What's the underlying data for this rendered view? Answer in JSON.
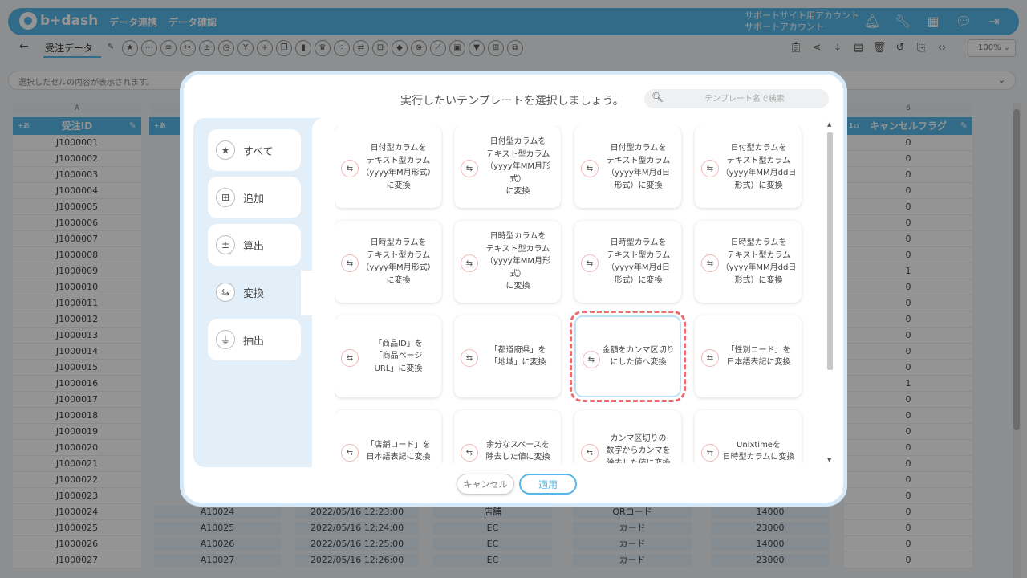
{
  "app": {
    "logo": "b+dash",
    "nav": [
      "データ連携",
      "データ確認"
    ],
    "account_line1": "サポートサイト用アカウント",
    "account_line2": "サポートアカウント",
    "top_icons": [
      "bell-icon",
      "wrench-icon",
      "grid-icon",
      "chat-icon",
      "logout-icon"
    ]
  },
  "toolbar": {
    "sheet_tab": "受注データ",
    "zoom": "100%"
  },
  "cellbar": {
    "placeholder": "選択したセルの内容が表示されます。"
  },
  "grid": {
    "col_a_letter": "A",
    "col_a_header": "受注ID",
    "col_g_letter": "6",
    "col_g_header": "キャンセルフラグ",
    "rows": [
      {
        "id": "J1000001",
        "flag": "0"
      },
      {
        "id": "J1000002",
        "flag": "0"
      },
      {
        "id": "J1000003",
        "flag": "0"
      },
      {
        "id": "J1000004",
        "flag": "0"
      },
      {
        "id": "J1000005",
        "flag": "0"
      },
      {
        "id": "J1000006",
        "flag": "0"
      },
      {
        "id": "J1000007",
        "flag": "0"
      },
      {
        "id": "J1000008",
        "flag": "0"
      },
      {
        "id": "J1000009",
        "flag": "1"
      },
      {
        "id": "J1000010",
        "flag": "0"
      },
      {
        "id": "J1000011",
        "flag": "0"
      },
      {
        "id": "J1000012",
        "flag": "0"
      },
      {
        "id": "J1000013",
        "flag": "0"
      },
      {
        "id": "J1000014",
        "flag": "0"
      },
      {
        "id": "J1000015",
        "flag": "0"
      },
      {
        "id": "J1000016",
        "flag": "1"
      },
      {
        "id": "J1000017",
        "flag": "0"
      },
      {
        "id": "J1000018",
        "flag": "0"
      },
      {
        "id": "J1000019",
        "flag": "0"
      },
      {
        "id": "J1000020",
        "flag": "0"
      },
      {
        "id": "J1000021",
        "flag": "0"
      },
      {
        "id": "J1000022",
        "flag": "0"
      },
      {
        "id": "J1000023",
        "flag": "0"
      },
      {
        "id": "J1000024",
        "flag": "0"
      },
      {
        "id": "J1000025",
        "flag": "0"
      },
      {
        "id": "J1000026",
        "flag": "0"
      },
      {
        "id": "J1000027",
        "flag": "0"
      }
    ],
    "visible_rows": [
      {
        "b": "A10024",
        "c": "2022/05/16 12:23:00",
        "d": "店舗",
        "e": "QRコード",
        "f": "14000"
      },
      {
        "b": "A10025",
        "c": "2022/05/16 12:24:00",
        "d": "EC",
        "e": "カード",
        "f": "23000"
      },
      {
        "b": "A10026",
        "c": "2022/05/16 12:25:00",
        "d": "EC",
        "e": "カード",
        "f": "14000"
      },
      {
        "b": "A10027",
        "c": "2022/05/16 12:26:00",
        "d": "EC",
        "e": "カード",
        "f": "23000"
      }
    ]
  },
  "modal": {
    "title": "実行したいテンプレートを選択しましょう。",
    "search_placeholder": "テンプレート名で検索",
    "categories": [
      {
        "label": "すべて",
        "icon": "star-icon"
      },
      {
        "label": "追加",
        "icon": "plus-square-icon"
      },
      {
        "label": "算出",
        "icon": "calculator-icon"
      },
      {
        "label": "変換",
        "icon": "convert-icon"
      },
      {
        "label": "抽出",
        "icon": "filter-icon"
      }
    ],
    "active_category": "変換",
    "templates": [
      "日付型カラムを\nテキスト型カラム\n（yyyy年M月形式）\nに変換",
      "日付型カラムを\nテキスト型カラム\n（yyyy年MM月形\n式）\nに変換",
      "日付型カラムを\nテキスト型カラム\n（yyyy年M月d日\n形式）に変換",
      "日付型カラムを\nテキスト型カラム\n（yyyy年MM月dd日\n形式）に変換",
      "日時型カラムを\nテキスト型カラム\n（yyyy年M月形式）\nに変換",
      "日時型カラムを\nテキスト型カラム\n（yyyy年MM月形\n式）\nに変換",
      "日時型カラムを\nテキスト型カラム\n（yyyy年M月d日\n形式）に変換",
      "日時型カラムを\nテキスト型カラム\n（yyyy年MM月dd日\n形式）に変換",
      "「商品ID」を\n「商品ページ\nURL」に変換",
      "「都道府県」を\n「地域」に変換",
      "金額をカンマ区切り\nにした値へ変換",
      "「性別コード」を\n日本語表記に変換",
      "「店舗コード」を\n日本語表記に変換",
      "余分なスペースを\n除去した値に変換",
      "カンマ区切りの\n数字からカンマを\n除去した値に変換",
      "Unixtimeを\n日時型カラムに変換"
    ],
    "selected_template_index": 10,
    "cancel_label": "キャンセル",
    "apply_label": "適用"
  }
}
